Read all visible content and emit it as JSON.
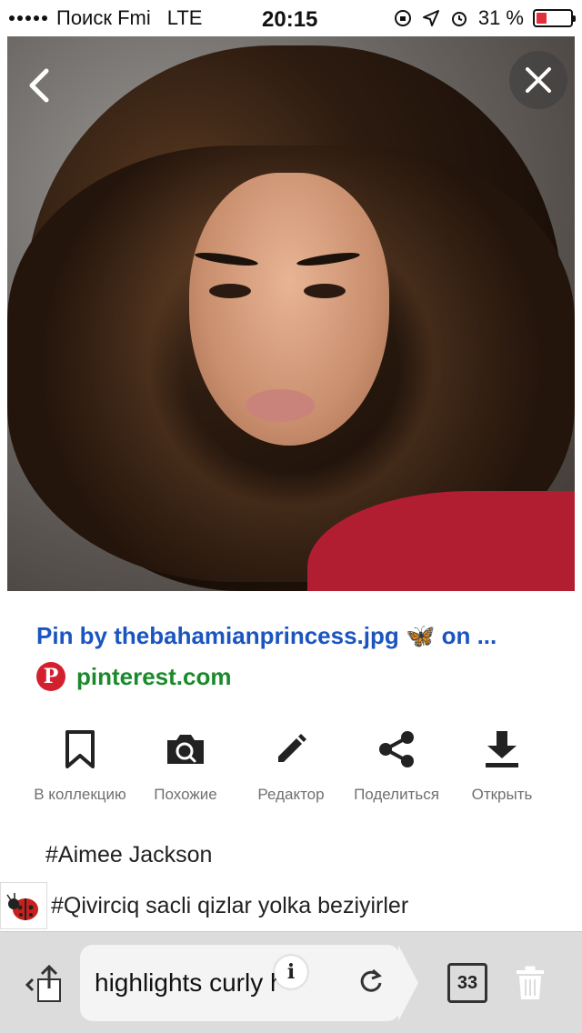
{
  "status_bar": {
    "carrier": "Поиск Fmi",
    "network": "LTE",
    "time": "20:15",
    "battery_percent": "31 %",
    "battery_level": 0.31,
    "battery_color": "#e0303b"
  },
  "viewer": {
    "back_icon": "chevron-left-icon",
    "close_icon": "close-icon"
  },
  "result": {
    "title": "Pin by thebahamianprincess.jpg 🦋 on ...",
    "source": "pinterest.com",
    "title_color": "#1a55c0",
    "source_color": "#1a8a2c"
  },
  "actions": [
    {
      "label": "В коллекцию",
      "icon": "bookmark-icon"
    },
    {
      "label": "Похожие",
      "icon": "camera-search-icon"
    },
    {
      "label": "Редактор",
      "icon": "pencil-icon"
    },
    {
      "label": "Поделиться",
      "icon": "share-icon"
    },
    {
      "label": "Открыть",
      "icon": "download-icon"
    }
  ],
  "tags": {
    "tag1": "#Aimee Jackson",
    "tag2": "#Qivirciq sacli qizlar yolka beziyirler"
  },
  "browser_bar": {
    "url_text": "highlights curly har",
    "info_icon": "i",
    "tab_count": "33"
  }
}
